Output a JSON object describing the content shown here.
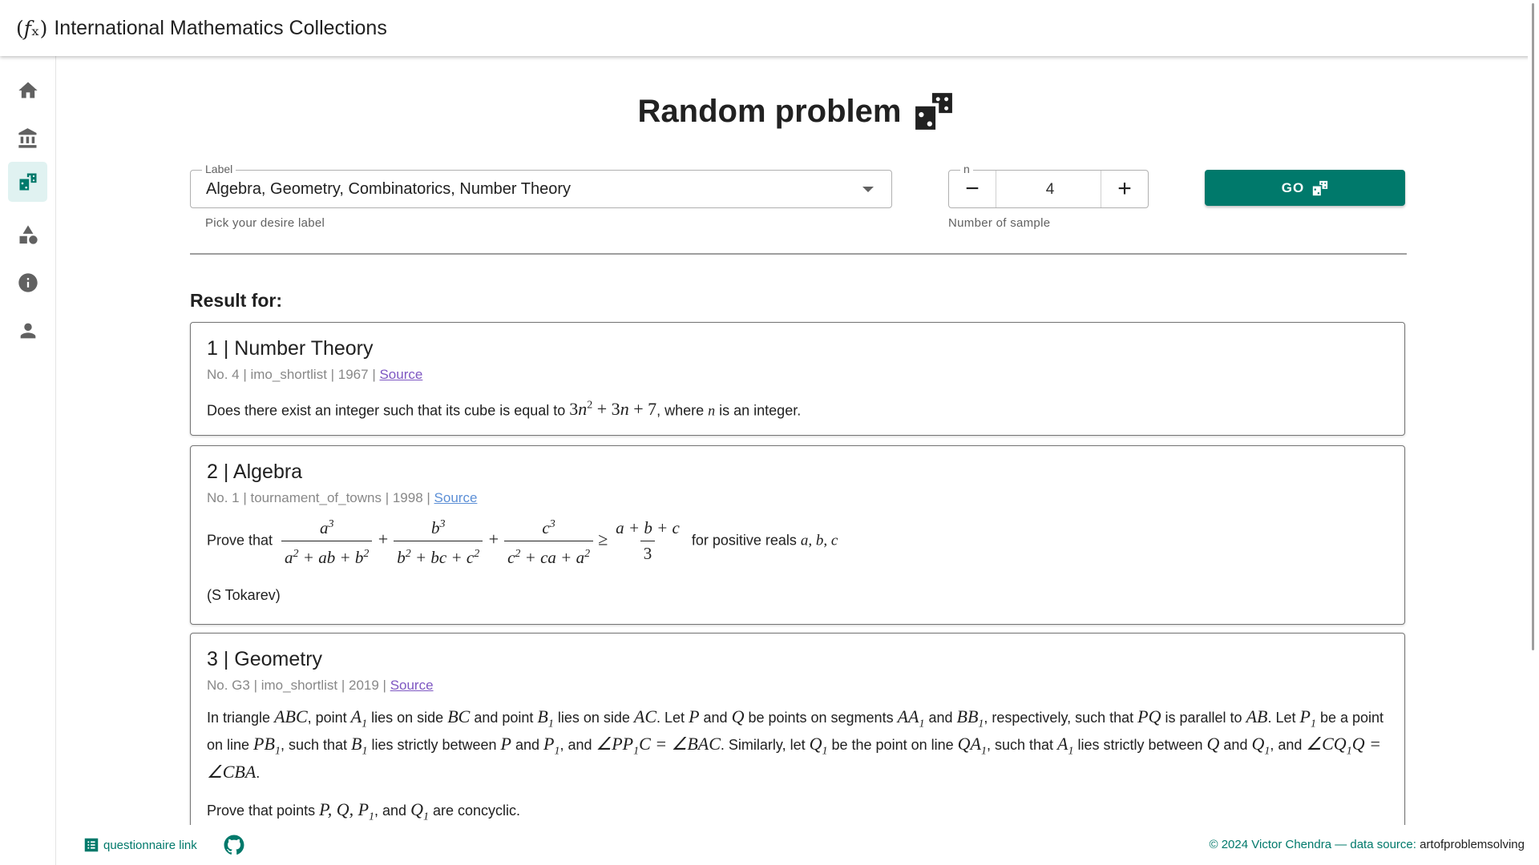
{
  "app": {
    "logo_text": "(𝑓ₓ)",
    "title": "International Mathematics Collections"
  },
  "nav": [
    {
      "icon": "home-icon",
      "active": false
    },
    {
      "icon": "institution-icon",
      "active": false
    },
    {
      "icon": "dice-icon",
      "active": true
    },
    {
      "icon": "shapes-icon",
      "active": false
    },
    {
      "icon": "info-icon",
      "active": false
    },
    {
      "icon": "person-icon",
      "active": false
    }
  ],
  "page": {
    "title": "Random problem"
  },
  "controls": {
    "label_field": {
      "label": "Label",
      "value": "Algebra, Geometry, Combinatorics, Number Theory",
      "helper": "Pick your desire label"
    },
    "n_field": {
      "label": "n",
      "value": "4",
      "helper": "Number of sample",
      "minus": "−",
      "plus": "+"
    },
    "go_label": "GO"
  },
  "results": {
    "heading": "Result for:",
    "items": [
      {
        "title": "1 | Number Theory",
        "meta": "No. 4 | imo_shortlist | 1967 | ",
        "source": "Source",
        "body_pre": "Does there exist an integer such that its cube is equal to ",
        "body_mid": ", where ",
        "body_post": " is an integer."
      },
      {
        "title": "2 | Algebra",
        "meta": "No. 1 | tournament_of_towns | 1998 | ",
        "source": "Source",
        "body_pre": "Prove that ",
        "body_post": " for positive reals ",
        "body_vars": "a, b, c",
        "author": "(S Tokarev)"
      },
      {
        "title": "3 | Geometry",
        "meta": "No. G3 | imo_shortlist | 2019 | ",
        "source": "Source",
        "conclusion_pre": "Prove that points ",
        "conclusion_post": " are concyclic."
      }
    ]
  },
  "footer": {
    "questionnaire": "questionnaire link",
    "copyright": "© 2024 Victor Chendra — data source: ",
    "data_source": "artofproblemsolving"
  },
  "colors": {
    "primary": "#00796b",
    "nav_active_bg": "#e0f2f1",
    "source_link": "#7e57c2"
  }
}
